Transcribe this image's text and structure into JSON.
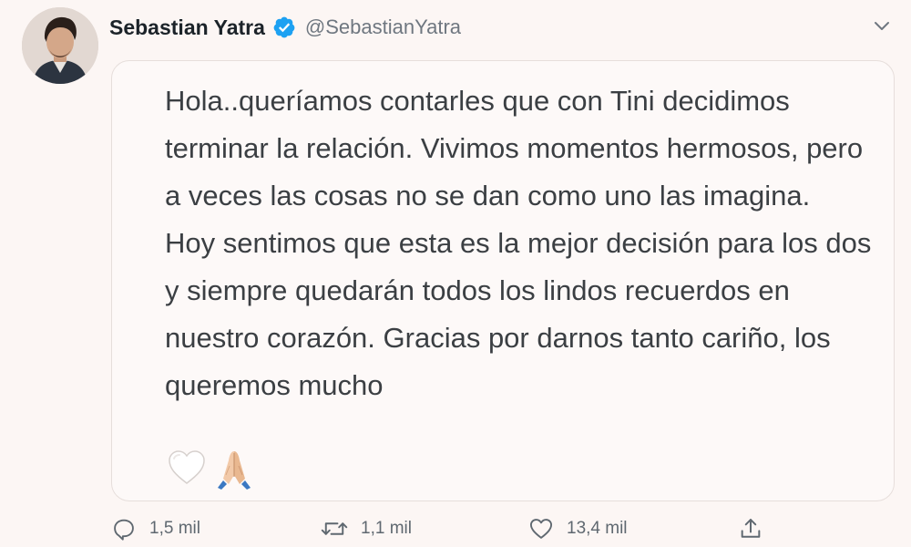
{
  "author": {
    "display_name": "Sebastian Yatra",
    "handle": "@SebastianYatra",
    "verified": true
  },
  "tweet": {
    "paragraphs": [
      "Hola..queríamos contarles que con Tini decidimos terminar la relación. Vivimos momentos hermosos, pero a veces las cosas no se dan como uno las imagina.",
      "Hoy sentimos que esta es la mejor decisión para los dos y siempre quedarán todos los lindos recuerdos en nuestro corazón. Gracias por darnos tanto cariño, los queremos mucho"
    ],
    "emojis": [
      "white-heart",
      "folded-hands"
    ]
  },
  "actions": {
    "reply_count": "1,5 mil",
    "retweet_count": "1,1 mil",
    "like_count": "13,4 mil"
  },
  "colors": {
    "background": "#fcf6f4",
    "verified_blue": "#1da1f2",
    "name_text": "#1c2329",
    "muted_text": "#6f7780",
    "body_text": "#3b3f43"
  }
}
